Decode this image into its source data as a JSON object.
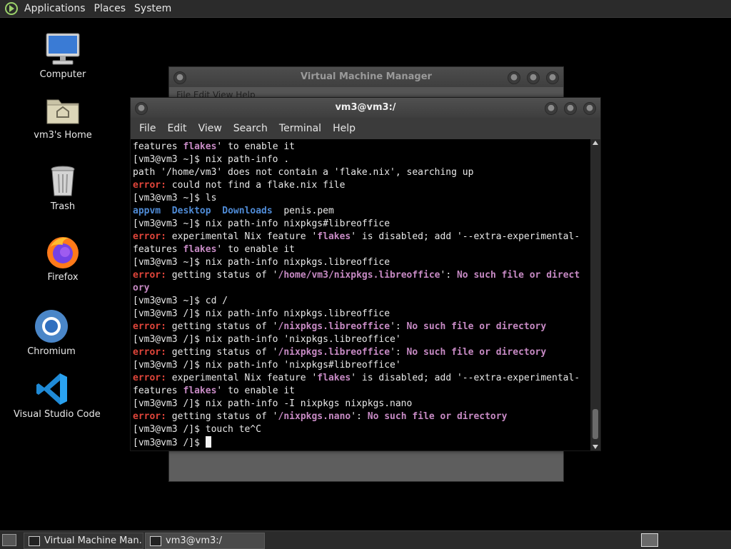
{
  "top_panel": {
    "menus": [
      "Applications",
      "Places",
      "System"
    ]
  },
  "desktop": {
    "icons": [
      {
        "label": "Computer",
        "icon": "computer-icon"
      },
      {
        "label": "vm3's Home",
        "icon": "home-folder-icon"
      },
      {
        "label": "Trash",
        "icon": "trash-icon"
      },
      {
        "label": "Firefox",
        "icon": "firefox-icon"
      },
      {
        "label": "Chromium",
        "icon": "chromium-icon"
      },
      {
        "label": "Visual Studio Code",
        "icon": "vscode-icon"
      }
    ]
  },
  "vmm_window": {
    "title": "Virtual Machine Manager",
    "menu_partial": "File   Edit   View   Help"
  },
  "terminal": {
    "title": "vm3@vm3:/",
    "menus": [
      "File",
      "Edit",
      "View",
      "Search",
      "Terminal",
      "Help"
    ],
    "lines": [
      [
        {
          "t": "features "
        },
        {
          "t": "flakes",
          "c": "mag"
        },
        {
          "t": "' to enable it"
        }
      ],
      [
        {
          "t": "[vm3@vm3 ~]$ nix path-info ."
        }
      ],
      [
        {
          "t": "path '/home/vm3' does not contain a 'flake.nix', searching up"
        }
      ],
      [
        {
          "t": "error:",
          "c": "red"
        },
        {
          "t": " could not find a flake.nix file"
        }
      ],
      [
        {
          "t": "[vm3@vm3 ~]$ ls"
        }
      ],
      [
        {
          "t": "appvm",
          "c": "blue"
        },
        {
          "t": "  "
        },
        {
          "t": "Desktop",
          "c": "blue"
        },
        {
          "t": "  "
        },
        {
          "t": "Downloads",
          "c": "blue"
        },
        {
          "t": "  penis.pem"
        }
      ],
      [
        {
          "t": "[vm3@vm3 ~]$ nix path-info nixpkgs#libreoffice"
        }
      ],
      [
        {
          "t": "error:",
          "c": "red"
        },
        {
          "t": " experimental Nix feature '"
        },
        {
          "t": "flakes",
          "c": "mag"
        },
        {
          "t": "' is disabled; add '--extra-experimental-"
        }
      ],
      [
        {
          "t": "features "
        },
        {
          "t": "flakes",
          "c": "mag"
        },
        {
          "t": "' to enable it"
        }
      ],
      [
        {
          "t": "[vm3@vm3 ~]$ nix path-info nixpkgs.libreoffice"
        }
      ],
      [
        {
          "t": "error:",
          "c": "red"
        },
        {
          "t": " getting status of '"
        },
        {
          "t": "/home/vm3/nixpkgs.libreoffice",
          "c": "mag"
        },
        {
          "t": "': "
        },
        {
          "t": "No such file or direct",
          "c": "mag"
        }
      ],
      [
        {
          "t": "ory",
          "c": "mag"
        }
      ],
      [
        {
          "t": "[vm3@vm3 ~]$ cd /"
        }
      ],
      [
        {
          "t": "[vm3@vm3 /]$ nix path-info nixpkgs.libreoffice"
        }
      ],
      [
        {
          "t": "error:",
          "c": "red"
        },
        {
          "t": " getting status of '"
        },
        {
          "t": "/nixpkgs.libreoffice",
          "c": "mag"
        },
        {
          "t": "': "
        },
        {
          "t": "No such file or directory",
          "c": "mag"
        }
      ],
      [
        {
          "t": "[vm3@vm3 /]$ nix path-info 'nixpkgs.libreoffice'"
        }
      ],
      [
        {
          "t": "error:",
          "c": "red"
        },
        {
          "t": " getting status of '"
        },
        {
          "t": "/nixpkgs.libreoffice",
          "c": "mag"
        },
        {
          "t": "': "
        },
        {
          "t": "No such file or directory",
          "c": "mag"
        }
      ],
      [
        {
          "t": "[vm3@vm3 /]$ nix path-info 'nixpkgs#libreoffice'"
        }
      ],
      [
        {
          "t": "error:",
          "c": "red"
        },
        {
          "t": " experimental Nix feature '"
        },
        {
          "t": "flakes",
          "c": "mag"
        },
        {
          "t": "' is disabled; add '--extra-experimental-"
        }
      ],
      [
        {
          "t": "features "
        },
        {
          "t": "flakes",
          "c": "mag"
        },
        {
          "t": "' to enable it"
        }
      ],
      [
        {
          "t": "[vm3@vm3 /]$ nix path-info -I nixpkgs nixpkgs.nano"
        }
      ],
      [
        {
          "t": "error:",
          "c": "red"
        },
        {
          "t": " getting status of '"
        },
        {
          "t": "/nixpkgs.nano",
          "c": "mag"
        },
        {
          "t": "': "
        },
        {
          "t": "No such file or directory",
          "c": "mag"
        }
      ],
      [
        {
          "t": "[vm3@vm3 /]$ touch te^C"
        }
      ],
      [
        {
          "t": "[vm3@vm3 /]$ "
        }
      ]
    ],
    "colors": {
      "red": "#e0453a",
      "mag": "#c78ac4",
      "blue": "#4f8bd6"
    }
  },
  "taskbar": {
    "tasks": [
      {
        "label": "Virtual Machine Man...",
        "active": false
      },
      {
        "label": "vm3@vm3:/",
        "active": true
      }
    ]
  }
}
